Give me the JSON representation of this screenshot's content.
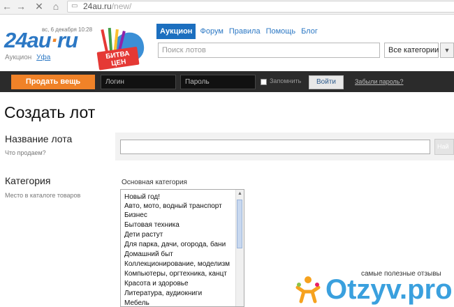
{
  "browser": {
    "url_host": "24au.ru",
    "url_path": "/new/"
  },
  "header": {
    "logo": {
      "main": "24au",
      "dot": "·",
      "tld": "ru"
    },
    "date": "вс, 6 декабря 10:28",
    "section": "Аукцион",
    "city": "Уфа",
    "promo_line1": "БИТВА",
    "promo_line2": "ЦЕН",
    "tabs": [
      {
        "label": "Аукцион",
        "active": true
      },
      {
        "label": "Форум",
        "active": false
      },
      {
        "label": "Правила",
        "active": false
      },
      {
        "label": "Помощь",
        "active": false
      },
      {
        "label": "Блог",
        "active": false
      }
    ],
    "search_placeholder": "Поиск лотов",
    "category_selected": "Все категории"
  },
  "userbar": {
    "sell_button": "Продать вещь",
    "login_placeholder": "Логин",
    "password_placeholder": "Пароль",
    "remember_label": "Запомнить",
    "login_button": "Войти",
    "forgot_link": "Забыли пароль?"
  },
  "form": {
    "title": "Создать лот",
    "name_label": "Название лота",
    "name_hint": "Что продаем?",
    "find_button": "Най",
    "category_label": "Категория",
    "category_hint": "Место в каталоге товаров",
    "main_category_label": "Основная категория",
    "categories": [
      "Новый год!",
      "Авто, мото, водный транспорт",
      "Бизнес",
      "Бытовая техника",
      "Дети растут",
      "Для парка, дачи, огорода, бани",
      "Домашний быт",
      "Коллекционирование, моделизм",
      "Компьютеры, оргтехника, канцт",
      "Красота и здоровье",
      "Литература, аудиокниги",
      "Мебель"
    ]
  },
  "watermark": {
    "tagline": "самые полезные отзывы",
    "brand": "Otzyv.pro"
  },
  "colors": {
    "brand_blue": "#2c78c4",
    "accent_orange": "#f08228",
    "dark_bar": "#2b2b2b"
  }
}
